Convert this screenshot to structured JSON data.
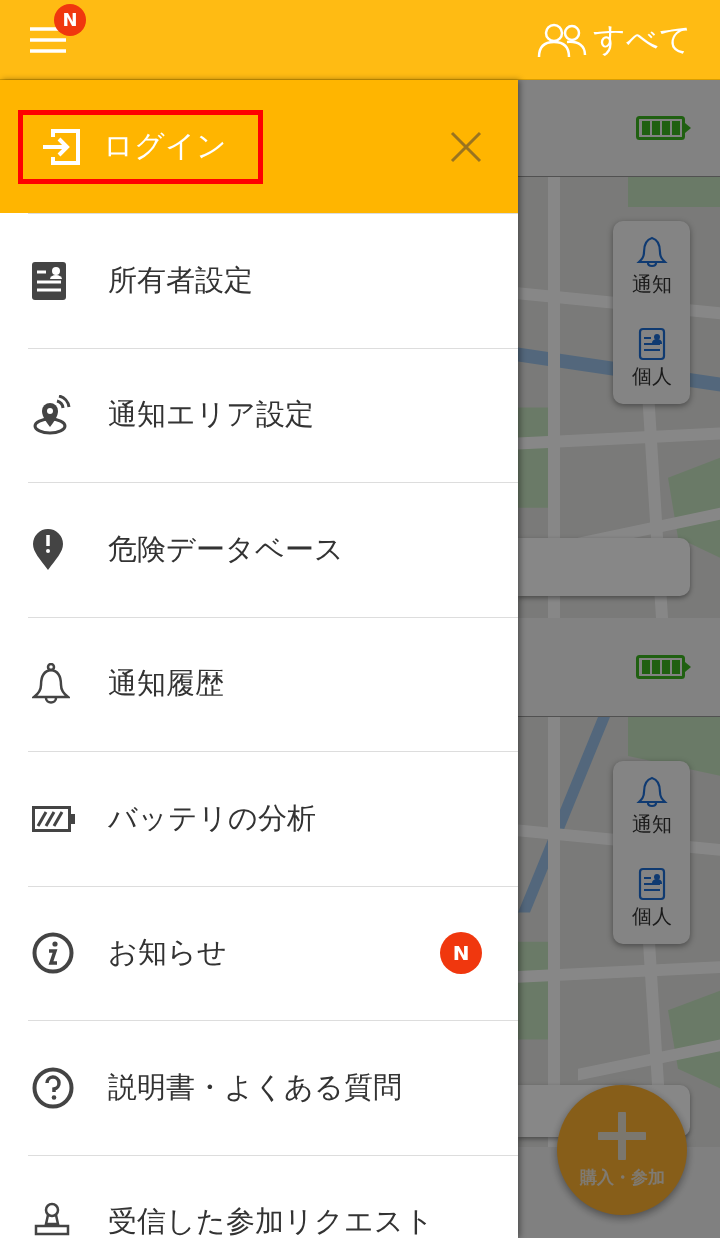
{
  "header": {
    "menu_badge": "N",
    "filter_label": "すべて"
  },
  "drawer": {
    "login": {
      "label": "ログイン",
      "highlighted": true
    },
    "items": [
      {
        "label": "所有者設定"
      },
      {
        "label": "通知エリア設定"
      },
      {
        "label": "危険データベース"
      },
      {
        "label": "通知履歴"
      },
      {
        "label": "バッテリの分析"
      },
      {
        "label": "お知らせ",
        "badge": "N"
      },
      {
        "label": "説明書・よくある質問"
      },
      {
        "label": "受信した参加リクエスト"
      }
    ]
  },
  "background": {
    "cards": [
      {
        "buttons": [
          "通知",
          "個人"
        ]
      },
      {
        "buttons": [
          "通知",
          "個人"
        ]
      }
    ],
    "fab": {
      "label": "購入・参加"
    }
  }
}
